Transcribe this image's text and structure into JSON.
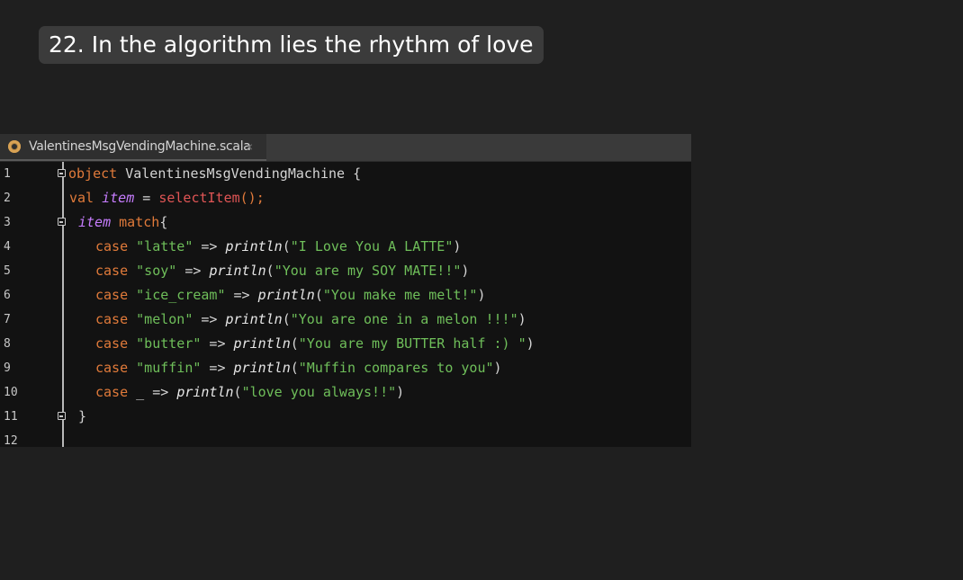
{
  "slide": {
    "title": "22.  In the algorithm lies the rhythm of love"
  },
  "editor": {
    "tab": {
      "filename": "ValentinesMsgVendingMachine.scala",
      "close_glyph": "×"
    },
    "lines": [
      {
        "num": "1",
        "kw1": "object",
        "rest": " ValentinesMsgVendingMachine {"
      },
      {
        "num": "2",
        "kw1": "val",
        "ident": "item",
        "op": " = ",
        "call": "selectItem",
        "tail": "();"
      },
      {
        "num": "3",
        "ident": "item",
        "kw1": " match",
        "tail": "{"
      },
      {
        "num": "4",
        "kw1": "case",
        "lit": " \"latte\"",
        "arrow": " => ",
        "fn": "println",
        "open": "(",
        "str": "\"I Love You A LATTE\"",
        "close": ")"
      },
      {
        "num": "5",
        "kw1": "case",
        "lit": " \"soy\"",
        "arrow": " => ",
        "fn": "println",
        "open": "(",
        "str": "\"You are my SOY MATE!!\"",
        "close": ")"
      },
      {
        "num": "6",
        "kw1": "case",
        "lit": " \"ice_cream\"",
        "arrow": " => ",
        "fn": "println",
        "open": "(",
        "str": "\"You make me melt!\"",
        "close": ")"
      },
      {
        "num": "7",
        "kw1": "case",
        "lit": " \"melon\"",
        "arrow": " => ",
        "fn": "println",
        "open": "(",
        "str": "\"You are one in a melon !!!\"",
        "close": ")"
      },
      {
        "num": "8",
        "kw1": "case",
        "lit": " \"butter\"",
        "arrow": " => ",
        "fn": "println",
        "open": "(",
        "str": "\"You are my BUTTER half :) \"",
        "close": ")"
      },
      {
        "num": "9",
        "kw1": "case",
        "lit": " \"muffin\"",
        "arrow": " => ",
        "fn": "println",
        "open": "(",
        "str": "\"Muffin compares to you\"",
        "close": ")"
      },
      {
        "num": "10",
        "kw1": "case",
        "lit": " _",
        "arrow": " => ",
        "fn": "println",
        "open": "(",
        "str": "\"love you always!!\"",
        "close": ")"
      },
      {
        "num": "11",
        "rest": "}"
      },
      {
        "num": "12"
      }
    ]
  },
  "colors": {
    "keyword": "#e07a3a",
    "identifier": "#c77dff",
    "call": "#e05555",
    "string": "#6fbf5a"
  }
}
